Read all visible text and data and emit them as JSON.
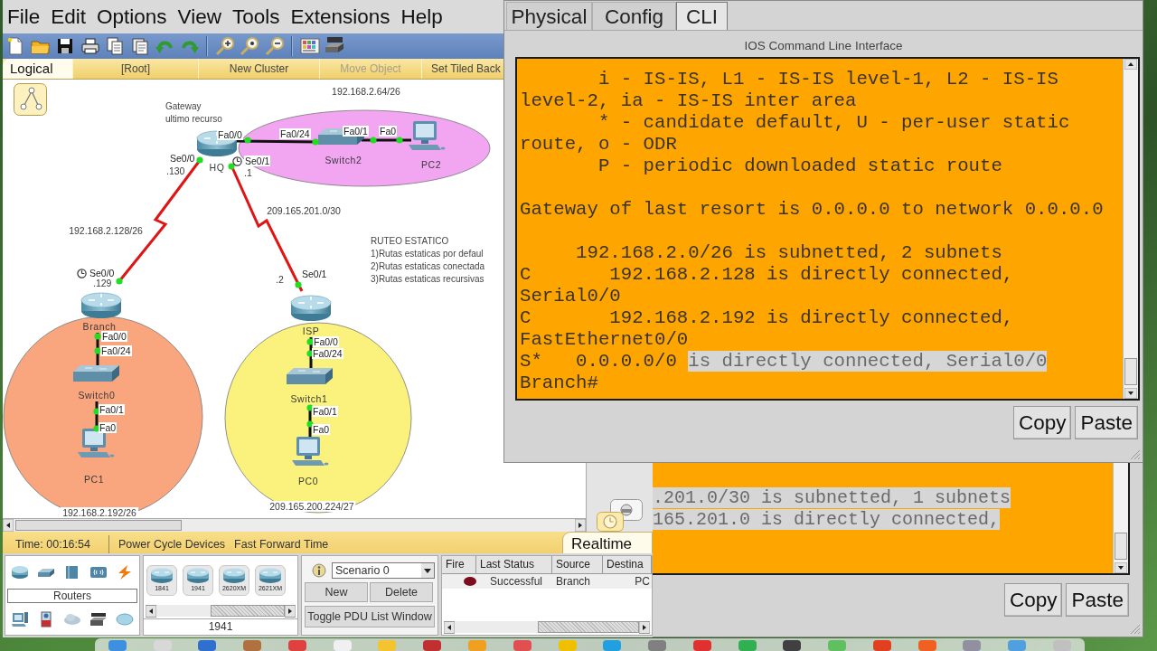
{
  "menu_bar": {
    "items": [
      "File",
      "Edit",
      "Options",
      "View",
      "Tools",
      "Extensions",
      "Help"
    ]
  },
  "workspace_bar": {
    "tab": {
      "label": "Logical",
      "selected": true
    },
    "items": [
      {
        "label": "[Root]",
        "disabled": false
      },
      {
        "label": "New Cluster",
        "disabled": false
      },
      {
        "label": "Move Object",
        "disabled": true
      },
      {
        "label": "Set Tiled Back",
        "disabled": false
      }
    ]
  },
  "topology": {
    "areas": [
      {
        "label": "192.168.2.64/26",
        "color": "#f2a6f2"
      },
      {
        "label": "192.168.2.192/26",
        "color": "#f9a57e"
      },
      {
        "label": "209.165.200.224/27",
        "color": "#faf27c"
      }
    ],
    "devices": [
      {
        "kind": "router",
        "name": "HQ"
      },
      {
        "kind": "switch",
        "name": "Switch2"
      },
      {
        "kind": "pc",
        "name": "PC2"
      },
      {
        "kind": "router",
        "name": "Branch"
      },
      {
        "kind": "switch",
        "name": "Switch0"
      },
      {
        "kind": "pc",
        "name": "PC1"
      },
      {
        "kind": "router",
        "name": "ISP"
      },
      {
        "kind": "switch",
        "name": "Switch1"
      },
      {
        "kind": "pc",
        "name": "PC0"
      }
    ],
    "links": [
      {
        "kind": "ethernet",
        "up": true
      },
      {
        "kind": "ethernet",
        "up": true
      },
      {
        "kind": "serial",
        "up": true,
        "label": "192.168.2.128/26"
      },
      {
        "kind": "serial",
        "up": true,
        "label": "209.165.201.0/30"
      },
      {
        "kind": "ethernet",
        "up": true
      },
      {
        "kind": "ethernet",
        "up": true
      },
      {
        "kind": "ethernet",
        "up": true
      },
      {
        "kind": "ethernet",
        "up": true
      }
    ],
    "port_labels": [
      {
        "text": "Fa0/0",
        "clock": false
      },
      {
        "text": "Fa0/24",
        "clock": false
      },
      {
        "text": "Fa0/1",
        "clock": false
      },
      {
        "text": "Fa0",
        "clock": false
      },
      {
        "text": "Se0/0",
        "clock": false
      },
      {
        "text": "Se0/1",
        "clock": true
      },
      {
        "text": "Se0/0",
        "clock": true
      },
      {
        "text": "Fa0/0",
        "clock": false
      },
      {
        "text": "Fa0/24",
        "clock": false
      },
      {
        "text": "Fa0/1",
        "clock": false
      },
      {
        "text": "Fa0",
        "clock": false
      },
      {
        "text": "Se0/1",
        "clock": false
      },
      {
        "text": "Fa0/0",
        "clock": false
      },
      {
        "text": "Fa0/24",
        "clock": false
      },
      {
        "text": "Fa0/1",
        "clock": false
      },
      {
        "text": "Fa0",
        "clock": false
      }
    ],
    "address_labels": [
      ".130",
      ".1",
      ".129",
      ".2"
    ],
    "notes": [
      {
        "lines": [
          "Gateway",
          "ultimo recurso"
        ]
      },
      {
        "lines": [
          "RUTEO ESTATICO",
          "1)Rutas estaticas por defaul",
          "2)Rutas estaticas conectada",
          "3)Rutas estaticas recursivas"
        ]
      }
    ]
  },
  "status_bar": {
    "time": "Time: 00:16:54",
    "actions": [
      "Power Cycle Devices",
      "Fast Forward Time"
    ],
    "mode": {
      "label": "Realtime",
      "selected": true
    }
  },
  "device_panel": {
    "category": "Routers",
    "models": [
      "1841",
      "1941",
      "2620XM",
      "2621XM"
    ],
    "model_label": "1941"
  },
  "scenario_panel": {
    "scenario": "Scenario 0",
    "buttons": [
      "New",
      "Delete",
      "Toggle PDU List Window"
    ]
  },
  "pdu_list": {
    "columns": [
      "Fire",
      "Last Status",
      "Source",
      "Destina"
    ],
    "rows": [
      {
        "color": "#7a0c1c",
        "last_status": "Successful",
        "source": "Branch",
        "destination": "PC"
      }
    ]
  },
  "cli_window": {
    "tabs": [
      {
        "label": "Physical",
        "selected": false
      },
      {
        "label": "Config",
        "selected": false
      },
      {
        "label": "CLI",
        "selected": true
      }
    ],
    "title": "IOS Command Line Interface",
    "terminal": {
      "lines": [
        {
          "kind": "text",
          "parts": [
            {
              "text": "       i - IS-IS, L1 - IS-IS level-1, L2 - IS-IS",
              "selected": false
            }
          ]
        },
        {
          "kind": "text",
          "parts": [
            {
              "text": "level-2, ia - IS-IS inter area",
              "selected": false
            }
          ]
        },
        {
          "kind": "text",
          "parts": [
            {
              "text": "       * - candidate default, U - per-user static",
              "selected": false
            }
          ]
        },
        {
          "kind": "text",
          "parts": [
            {
              "text": "route, o - ODR",
              "selected": false
            }
          ]
        },
        {
          "kind": "text",
          "parts": [
            {
              "text": "       P - periodic downloaded static route",
              "selected": false
            }
          ]
        },
        {
          "kind": "blank"
        },
        {
          "kind": "text",
          "parts": [
            {
              "text": "Gateway of last resort is 0.0.0.0 to network 0.0.0.0",
              "selected": false
            }
          ]
        },
        {
          "kind": "blank"
        },
        {
          "kind": "text",
          "parts": [
            {
              "text": "     192.168.2.0/26 is subnetted, 2 subnets",
              "selected": false
            }
          ]
        },
        {
          "kind": "text",
          "parts": [
            {
              "text": "C       192.168.2.128 is directly connected,",
              "selected": false
            }
          ]
        },
        {
          "kind": "text",
          "parts": [
            {
              "text": "Serial0/0",
              "selected": false
            }
          ]
        },
        {
          "kind": "text",
          "parts": [
            {
              "text": "C       192.168.2.192 is directly connected,",
              "selected": false
            }
          ]
        },
        {
          "kind": "text",
          "parts": [
            {
              "text": "FastEthernet0/0",
              "selected": false
            }
          ]
        },
        {
          "kind": "text",
          "parts": [
            {
              "text": "S*   0.0.0.0/0 ",
              "selected": false
            },
            {
              "text": "is directly connected, Serial0/0",
              "selected": true
            }
          ]
        },
        {
          "kind": "text",
          "parts": [
            {
              "text": "Branch#",
              "selected": false
            }
          ]
        }
      ]
    },
    "buttons": [
      "Copy",
      "Paste"
    ]
  },
  "cli_window_back": {
    "terminal": {
      "lines": [
        {
          "kind": "text",
          "parts": [
            {
              "text": ".201.0/30 is subnetted, 1 subnets",
              "selected": true
            }
          ]
        },
        {
          "kind": "text",
          "parts": [
            {
              "text": "165.201.0 is directly connected,",
              "selected": true
            }
          ]
        }
      ]
    },
    "buttons": [
      "Copy",
      "Paste"
    ]
  }
}
